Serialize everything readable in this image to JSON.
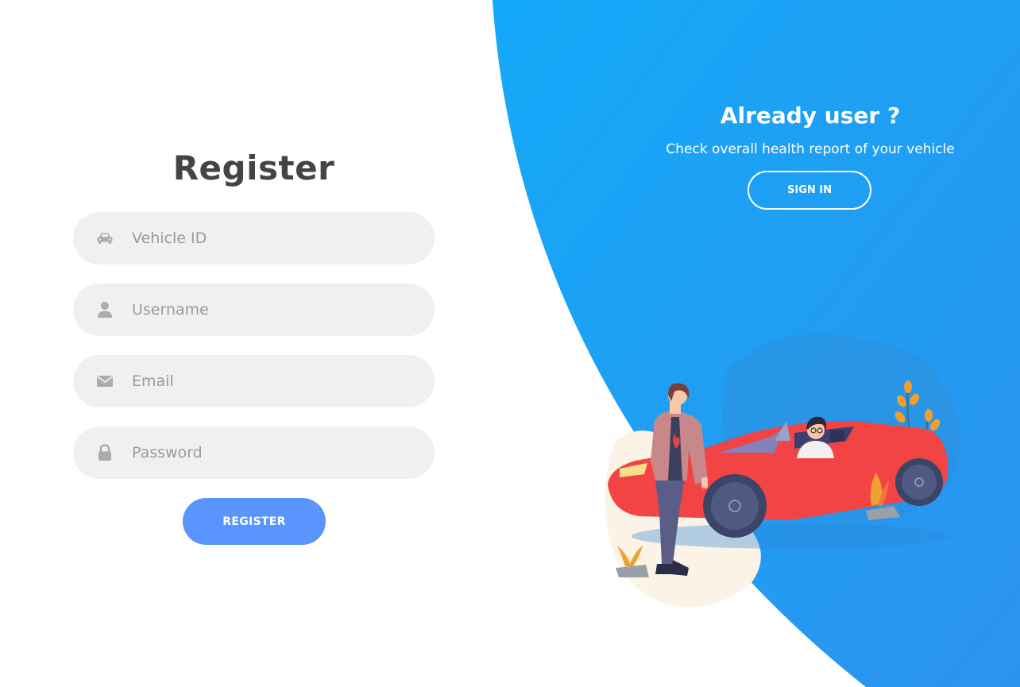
{
  "register": {
    "title": "Register",
    "vehicle_id_placeholder": "Vehicle ID",
    "username_placeholder": "Username",
    "email_placeholder": "Email",
    "password_placeholder": "Password",
    "submit_label": "REGISTER"
  },
  "signin_panel": {
    "title": "Already user ?",
    "subtitle": "Check overall health report of your vehicle",
    "button_label": "SIGN IN"
  },
  "icons": {
    "vehicle": "car-icon",
    "username": "user-icon",
    "email": "envelope-icon",
    "password": "lock-icon"
  },
  "colors": {
    "accent": "#5995fd",
    "panel_gradient_start": "#14a9f8",
    "panel_gradient_end": "#2b93ef",
    "field_bg": "#f0f0f0",
    "title_text": "#444444",
    "icon": "#acacac",
    "car": "#f24444"
  }
}
